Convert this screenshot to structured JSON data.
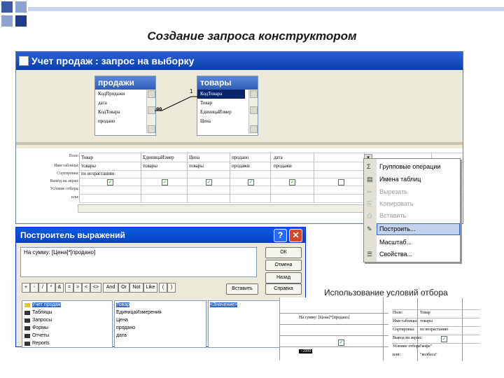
{
  "slide_title": "Создание запроса конструктором",
  "query_window": {
    "title": "Учет продаж : запрос на выборку",
    "tables": [
      {
        "name": "продажи",
        "fields": [
          "КодПродажи",
          "дата",
          "КодТовара",
          "продано"
        ]
      },
      {
        "name": "товары",
        "fields": [
          "КодТовара",
          "Товар",
          "ЕдиницаИзмер",
          "Цена"
        ]
      }
    ],
    "relation_one": "1",
    "relation_many": "∞",
    "row_labels": [
      "Поле:",
      "Имя таблицы:",
      "Сортировка:",
      "Вывод на экран:",
      "Условие отбора:",
      "или:"
    ],
    "columns": [
      {
        "field": "Товар",
        "table": "товары",
        "sort": "по возрастанию",
        "show": true
      },
      {
        "field": "ЕдиницаИзмер",
        "table": "товары",
        "sort": "",
        "show": true
      },
      {
        "field": "Цена",
        "table": "товары",
        "sort": "",
        "show": true
      },
      {
        "field": "продано",
        "table": "продажи",
        "sort": "",
        "show": true
      },
      {
        "field": "дата",
        "table": "продажи",
        "sort": "",
        "show": true
      },
      {
        "field": "",
        "table": "",
        "sort": "",
        "show": false
      }
    ]
  },
  "context_menu": {
    "items": [
      {
        "icon": "Σ",
        "label": "Групповые операции",
        "enabled": true
      },
      {
        "icon": "▤",
        "label": "Имена таблиц",
        "enabled": true
      },
      {
        "icon": "✂",
        "label": "Вырезать",
        "enabled": false
      },
      {
        "icon": "⎘",
        "label": "Копировать",
        "enabled": false
      },
      {
        "icon": "⎙",
        "label": "Вставить",
        "enabled": false
      },
      {
        "icon": "✎",
        "label": "Построить...",
        "enabled": true
      },
      {
        "icon": "",
        "label": "Масштаб...",
        "enabled": true
      },
      {
        "icon": "☰",
        "label": "Свойства...",
        "enabled": true
      }
    ]
  },
  "expression_builder": {
    "title": "Построитель выражений",
    "help_glyph": "?",
    "close_glyph": "✕",
    "expression": "На сумму: [Цена]*[продано]",
    "buttons": {
      "ok": "ОК",
      "cancel": "Отмена",
      "undo": "Назад",
      "paste": "Вставить",
      "help": "Справка"
    },
    "operators": [
      "+",
      "-",
      "/",
      "*",
      "&",
      "=",
      ">",
      "<",
      "<>",
      "And",
      "Or",
      "Not",
      "Like",
      "(",
      ")"
    ],
    "list1": [
      "Учет продаж",
      "Таблицы",
      "Запросы",
      "Формы",
      "Отчеты",
      "Reports"
    ],
    "list2": [
      "Товар",
      "ЕдиницаИзмерения",
      "Цена",
      "продано",
      "дата"
    ],
    "list3": [
      "<Значение>"
    ]
  },
  "caption_right": "Использование условий отбора",
  "snippet1": {
    "field": "На сумму: [Цена]*[продано]",
    "value": ">2000"
  },
  "snippet2": {
    "labels": [
      "Поле:",
      "Имя таблицы:",
      "Сортировка:",
      "Вывод на экран:",
      "Условие отбора:",
      "или:"
    ],
    "values": [
      "Товар",
      "товары",
      "по возрастанию",
      "",
      "\"кофе\"",
      "\"колбаса\""
    ]
  },
  "colors": {
    "titlebar": "#0a3fae",
    "dialog_face": "#ece9d8",
    "selection": "#316ac5"
  }
}
